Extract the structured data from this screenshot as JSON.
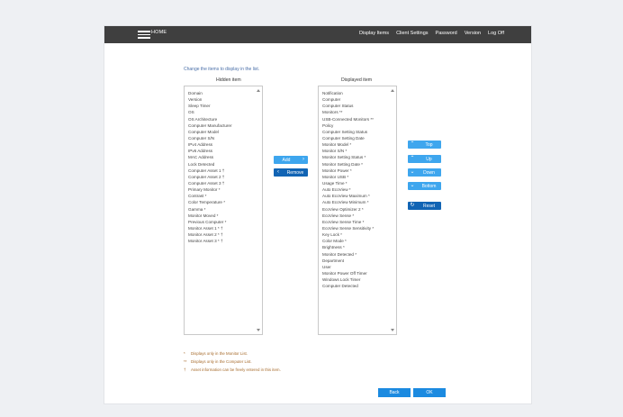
{
  "nav": {
    "home_label": "HOME",
    "links": [
      "Display Items",
      "Client Settings",
      "Password",
      "Version",
      "Log Off"
    ]
  },
  "instruction": "Change the items to display in the list.",
  "hidden": {
    "title": "Hidden item",
    "items": [
      "Domain",
      "Version",
      "Sleep Timer",
      "OS",
      "OS Architecture",
      "Computer Manufacturer",
      "Computer Model",
      "Computer S/N",
      "IPv4 Address",
      "IPv6 Address",
      "MAC Address",
      "Lock Detected",
      "Computer Asset 1 †",
      "Computer Asset 2 †",
      "Computer Asset 3 †",
      "Primary Monitor *",
      "Contrast *",
      "Color Temperature *",
      "Gamma *",
      "Monitor Moved *",
      "Previous Computer *",
      "Monitor Asset 1 * †",
      "Monitor Asset 2 * †",
      "Monitor Asset 3 * †"
    ]
  },
  "displayed": {
    "title": "Displayed item",
    "items": [
      "Notification",
      "Computer",
      "Computer Status",
      "Monitors **",
      "USB-Connected Monitors **",
      "Policy",
      "Computer Setting Status",
      "Computer Setting Date",
      "Monitor Model *",
      "Monitor S/N *",
      "Monitor Setting Status *",
      "Monitor Setting Date *",
      "Monitor Power *",
      "Monitor USB *",
      "Usage Time *",
      "Auto EcoView *",
      "Auto EcoView Maximum *",
      "Auto EcoView Minimum *",
      "EcoView Optimizer 2 *",
      "EcoView Sense *",
      "EcoView Sense Time *",
      "EcoView Sense Sensitivity *",
      "Key Lock *",
      "Color Mode *",
      "Brightness *",
      "Monitor Detected *",
      "Department",
      "User",
      "Monitor Power Off Timer",
      "Windows Lock Timer",
      "Computer Detected"
    ]
  },
  "buttons": {
    "add": "Add",
    "remove": "Remove",
    "top": "Top",
    "up": "Up",
    "down": "Down",
    "bottom": "Bottom",
    "reset": "Reset",
    "back": "Back",
    "ok": "OK"
  },
  "notes": [
    {
      "mark": "*",
      "text": "Displays only in the Monitor List."
    },
    {
      "mark": "**",
      "text": "Displays only in the Computer List."
    },
    {
      "mark": "†",
      "text": "Asset information can be freely entered in this item."
    }
  ],
  "colors": {
    "navbar": "#3f3f3f",
    "button_light": "#3ea6ee",
    "button_dark": "#1164b4",
    "footer_button": "#1b8ae0",
    "note_text": "#a66a2a",
    "instruction_text": "#4a6fa8"
  },
  "icons": {
    "add": "chevron-right-icon",
    "remove": "chevron-left-icon",
    "top": "double-chevron-up-icon",
    "up": "chevron-up-icon",
    "down": "chevron-down-icon",
    "bottom": "double-chevron-down-icon",
    "reset": "refresh-icon",
    "menu": "hamburger-menu-icon"
  }
}
